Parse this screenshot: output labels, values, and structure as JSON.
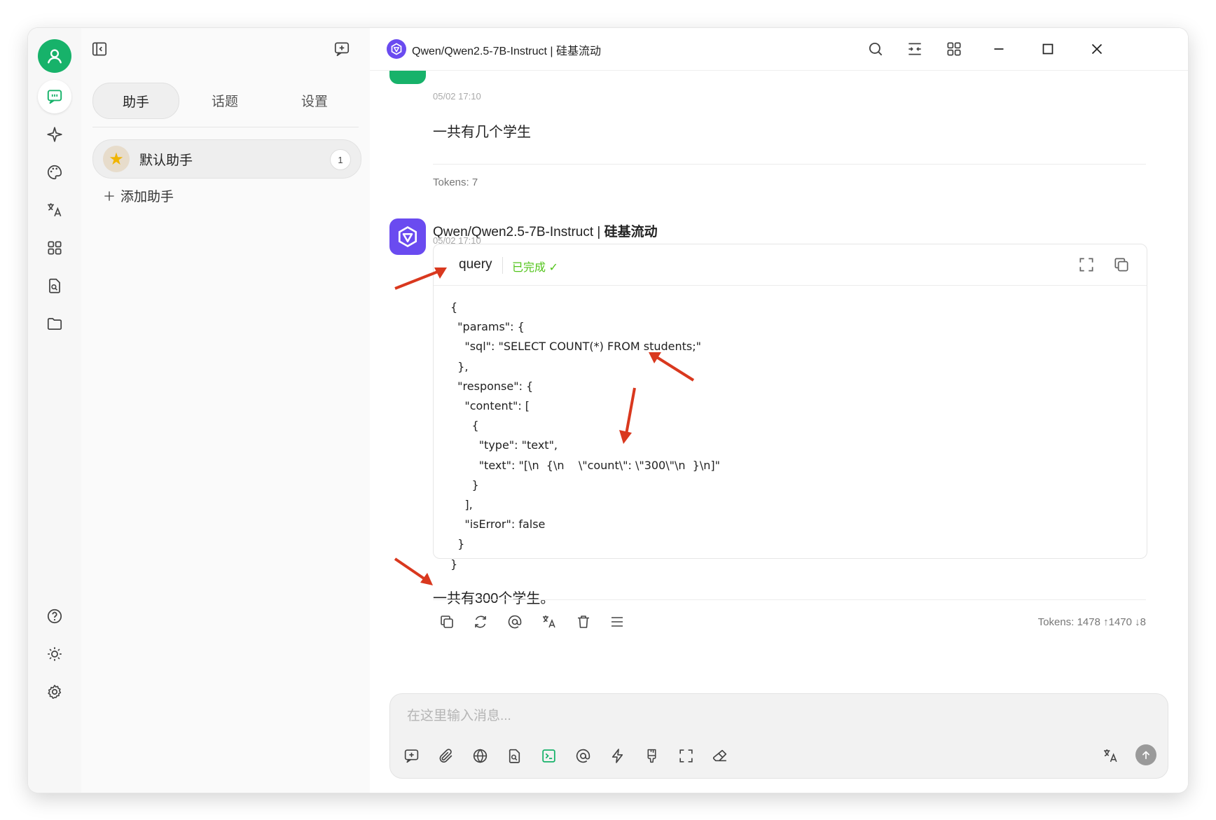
{
  "window": {
    "title_model": "Qwen/Qwen2.5-7B-Instruct | 硅基流动"
  },
  "sidebar": {
    "tabs": [
      {
        "label": "助手",
        "active": true
      },
      {
        "label": "话题",
        "active": false
      },
      {
        "label": "设置",
        "active": false
      }
    ],
    "assistant": {
      "name": "默认助手",
      "count": "1"
    },
    "add_label": "添加助手"
  },
  "chat": {
    "user_message": {
      "time": "05/02 17:10",
      "text": "一共有几个学生",
      "tokens": "Tokens: 7"
    },
    "ai_message": {
      "name_model": "Qwen/Qwen2.5-7B-Instruct | ",
      "name_provider": "硅基流动",
      "time": "05/02 17:10",
      "tool": {
        "name": "query",
        "status": "已完成 ✓",
        "code": "{\n  \"params\": {\n    \"sql\": \"SELECT COUNT(*) FROM students;\"\n  },\n  \"response\": {\n    \"content\": [\n      {\n        \"type\": \"text\",\n        \"text\": \"[\\n  {\\n    \\\"count\\\": \\\"300\\\"\\n  }\\n]\"\n      }\n    ],\n    \"isError\": false\n  }\n}"
      },
      "answer": "一共有300个学生。",
      "tokens": "Tokens: 1478 ↑1470 ↓8"
    }
  },
  "input": {
    "placeholder": "在这里输入消息..."
  },
  "colors": {
    "accent_green": "#17b26a",
    "qwen_purple": "#6a4bf0",
    "status_green": "#52c41a",
    "annotation_red": "#d9381e"
  }
}
